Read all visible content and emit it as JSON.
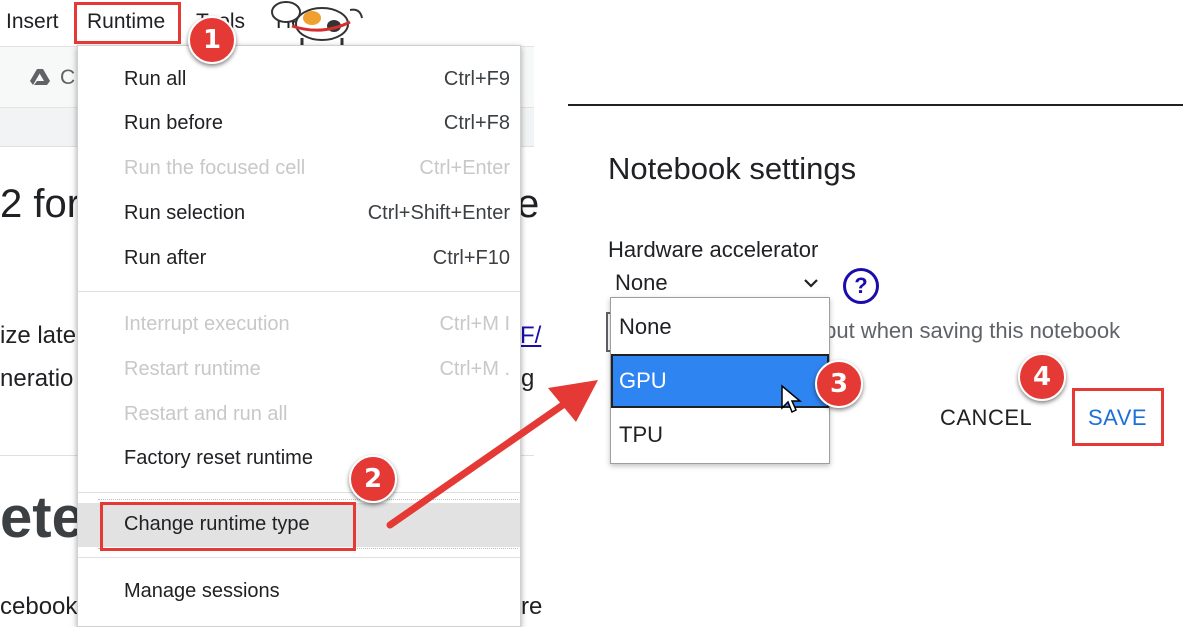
{
  "menubar": {
    "items": [
      "Insert",
      "Runtime",
      "Tools",
      "Help"
    ]
  },
  "toolbar": {
    "drive_label": "C"
  },
  "background": {
    "heading": "2 for",
    "line1": "ize late",
    "line2": "neratio",
    "big_heading": "ete",
    "line3": "cebook",
    "right_fragments": [
      "e",
      "F/",
      "g",
      "re"
    ]
  },
  "runtime_menu": {
    "items": [
      {
        "label": "Run all",
        "shortcut": "Ctrl+F9",
        "enabled": true
      },
      {
        "label": "Run before",
        "shortcut": "Ctrl+F8",
        "enabled": true
      },
      {
        "label": "Run the focused cell",
        "shortcut": "Ctrl+Enter",
        "enabled": false
      },
      {
        "label": "Run selection",
        "shortcut": "Ctrl+Shift+Enter",
        "enabled": true
      },
      {
        "label": "Run after",
        "shortcut": "Ctrl+F10",
        "enabled": true
      },
      {
        "label": "Interrupt execution",
        "shortcut": "Ctrl+M I",
        "enabled": false
      },
      {
        "label": "Restart runtime",
        "shortcut": "Ctrl+M .",
        "enabled": false
      },
      {
        "label": "Restart and run all",
        "shortcut": "",
        "enabled": false
      },
      {
        "label": "Factory reset runtime",
        "shortcut": "",
        "enabled": true
      },
      {
        "label": "Change runtime type",
        "shortcut": "",
        "enabled": true,
        "highlighted": true
      },
      {
        "label": "Manage sessions",
        "shortcut": "",
        "enabled": true
      }
    ]
  },
  "notebook_settings": {
    "title": "Notebook settings",
    "hardware_label": "Hardware accelerator",
    "selected_value": "None",
    "options": [
      "None",
      "GPU",
      "TPU"
    ],
    "highlighted_option": "GPU",
    "omit_output_text": "tput when saving this notebook",
    "cancel_label": "CANCEL",
    "save_label": "SAVE",
    "help_symbol": "?"
  },
  "annotations": {
    "step1": "1",
    "step2": "2",
    "step3": "3",
    "step4": "4"
  },
  "colors": {
    "accent_red": "#e53935",
    "save_blue": "#1e6fd9",
    "selected_blue": "#2e84f0"
  },
  "icons": [
    "google-drive-icon",
    "help-icon",
    "chevron-down-icon",
    "mouse-cursor-icon",
    "arrow-icon",
    "mascot-image"
  ]
}
